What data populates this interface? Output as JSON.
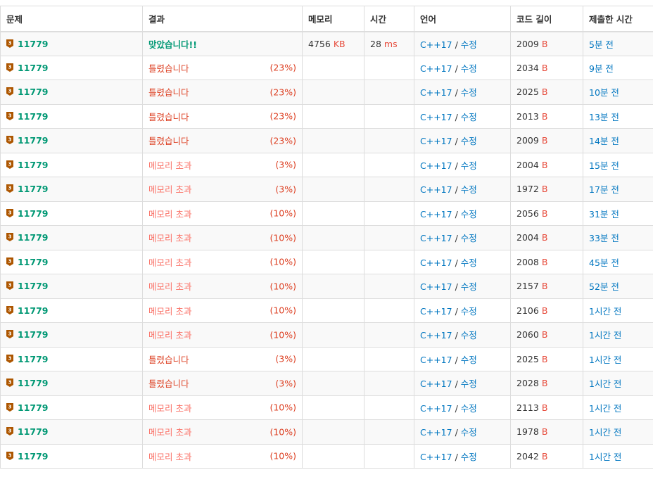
{
  "header": {
    "problem": "문제",
    "result": "결과",
    "memory": "메모리",
    "time": "시간",
    "language": "언어",
    "code_length": "코드 길이",
    "submitted_at": "제출한 시간"
  },
  "units": {
    "memory": "KB",
    "time": "ms",
    "code": "B"
  },
  "colors": {
    "accepted": "#009874",
    "wrong": "#dd4124",
    "memory_exceeded": "#fa7268",
    "link": "#0076c0",
    "unit": "#e74c3c",
    "badge": "#ad5600"
  },
  "rows": [
    {
      "problem": "11779",
      "result": "맞았습니다!!",
      "type": "ac",
      "percent": "",
      "memory": "4756",
      "time": "28",
      "lang": "C++17",
      "edit": "수정",
      "code": "2009",
      "submitted": "5분 전"
    },
    {
      "problem": "11779",
      "result": "틀렸습니다",
      "type": "wa",
      "percent": "(23%)",
      "memory": "",
      "time": "",
      "lang": "C++17",
      "edit": "수정",
      "code": "2034",
      "submitted": "9분 전"
    },
    {
      "problem": "11779",
      "result": "틀렸습니다",
      "type": "wa",
      "percent": "(23%)",
      "memory": "",
      "time": "",
      "lang": "C++17",
      "edit": "수정",
      "code": "2025",
      "submitted": "10분 전"
    },
    {
      "problem": "11779",
      "result": "틀렸습니다",
      "type": "wa",
      "percent": "(23%)",
      "memory": "",
      "time": "",
      "lang": "C++17",
      "edit": "수정",
      "code": "2013",
      "submitted": "13분 전"
    },
    {
      "problem": "11779",
      "result": "틀렸습니다",
      "type": "wa",
      "percent": "(23%)",
      "memory": "",
      "time": "",
      "lang": "C++17",
      "edit": "수정",
      "code": "2009",
      "submitted": "14분 전"
    },
    {
      "problem": "11779",
      "result": "메모리 초과",
      "type": "mle",
      "percent": "(3%)",
      "memory": "",
      "time": "",
      "lang": "C++17",
      "edit": "수정",
      "code": "2004",
      "submitted": "15분 전"
    },
    {
      "problem": "11779",
      "result": "메모리 초과",
      "type": "mle",
      "percent": "(3%)",
      "memory": "",
      "time": "",
      "lang": "C++17",
      "edit": "수정",
      "code": "1972",
      "submitted": "17분 전"
    },
    {
      "problem": "11779",
      "result": "메모리 초과",
      "type": "mle",
      "percent": "(10%)",
      "memory": "",
      "time": "",
      "lang": "C++17",
      "edit": "수정",
      "code": "2056",
      "submitted": "31분 전"
    },
    {
      "problem": "11779",
      "result": "메모리 초과",
      "type": "mle",
      "percent": "(10%)",
      "memory": "",
      "time": "",
      "lang": "C++17",
      "edit": "수정",
      "code": "2004",
      "submitted": "33분 전"
    },
    {
      "problem": "11779",
      "result": "메모리 초과",
      "type": "mle",
      "percent": "(10%)",
      "memory": "",
      "time": "",
      "lang": "C++17",
      "edit": "수정",
      "code": "2008",
      "submitted": "45분 전"
    },
    {
      "problem": "11779",
      "result": "메모리 초과",
      "type": "mle",
      "percent": "(10%)",
      "memory": "",
      "time": "",
      "lang": "C++17",
      "edit": "수정",
      "code": "2157",
      "submitted": "52분 전"
    },
    {
      "problem": "11779",
      "result": "메모리 초과",
      "type": "mle",
      "percent": "(10%)",
      "memory": "",
      "time": "",
      "lang": "C++17",
      "edit": "수정",
      "code": "2106",
      "submitted": "1시간 전"
    },
    {
      "problem": "11779",
      "result": "메모리 초과",
      "type": "mle",
      "percent": "(10%)",
      "memory": "",
      "time": "",
      "lang": "C++17",
      "edit": "수정",
      "code": "2060",
      "submitted": "1시간 전"
    },
    {
      "problem": "11779",
      "result": "틀렸습니다",
      "type": "wa",
      "percent": "(3%)",
      "memory": "",
      "time": "",
      "lang": "C++17",
      "edit": "수정",
      "code": "2025",
      "submitted": "1시간 전"
    },
    {
      "problem": "11779",
      "result": "틀렸습니다",
      "type": "wa",
      "percent": "(3%)",
      "memory": "",
      "time": "",
      "lang": "C++17",
      "edit": "수정",
      "code": "2028",
      "submitted": "1시간 전"
    },
    {
      "problem": "11779",
      "result": "메모리 초과",
      "type": "mle",
      "percent": "(10%)",
      "memory": "",
      "time": "",
      "lang": "C++17",
      "edit": "수정",
      "code": "2113",
      "submitted": "1시간 전"
    },
    {
      "problem": "11779",
      "result": "메모리 초과",
      "type": "mle",
      "percent": "(10%)",
      "memory": "",
      "time": "",
      "lang": "C++17",
      "edit": "수정",
      "code": "1978",
      "submitted": "1시간 전"
    },
    {
      "problem": "11779",
      "result": "메모리 초과",
      "type": "mle",
      "percent": "(10%)",
      "memory": "",
      "time": "",
      "lang": "C++17",
      "edit": "수정",
      "code": "2042",
      "submitted": "1시간 전"
    }
  ]
}
